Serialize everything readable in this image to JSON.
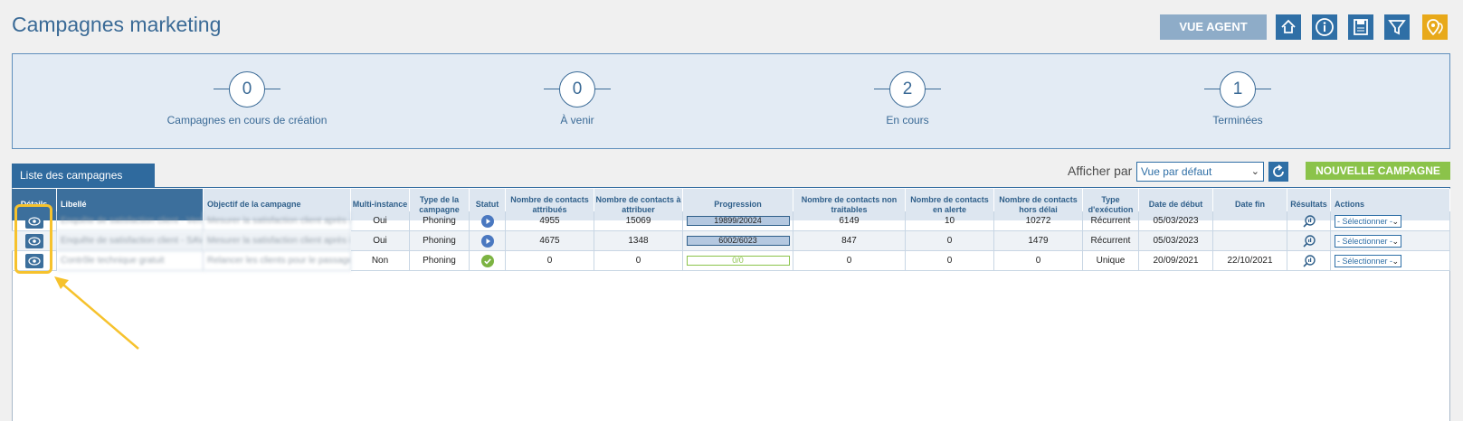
{
  "page": {
    "title": "Campagnes marketing"
  },
  "toolbar": {
    "agent_label": "VUE AGENT",
    "icons": [
      "export-icon",
      "info-icon",
      "save-icon",
      "filter-icon",
      "location-icon"
    ]
  },
  "stats": [
    {
      "value": "0",
      "label": "Campagnes en cours de création"
    },
    {
      "value": "0",
      "label": "À venir"
    },
    {
      "value": "2",
      "label": "En cours"
    },
    {
      "value": "1",
      "label": "Terminées"
    }
  ],
  "tab": {
    "label": "Liste des campagnes"
  },
  "display": {
    "label": "Afficher par",
    "selected": "Vue par défaut",
    "new_campaign": "NOUVELLE CAMPAGNE"
  },
  "table": {
    "headers": [
      "Détails",
      "Libellé",
      "Objectif de la campagne",
      "Multi-instance",
      "Type de la campagne",
      "Statut",
      "Nombre de contacts attribués",
      "Nombre de contacts à attribuer",
      "Progression",
      "Nombre de contacts non traitables",
      "Nombre de contacts en alerte",
      "Nombre de contacts hors délai",
      "Type d'exécution",
      "Date de début",
      "Date fin",
      "Résultats",
      "Actions"
    ],
    "rows": [
      {
        "libelle": "Enquête de satisfaction client - Vente",
        "objectif": "Mesurer la satisfaction client après achat",
        "multi": "Oui",
        "type": "Phoning",
        "statut": "en-cours",
        "attribues": "4955",
        "a_attribuer": "15069",
        "progression": "19899/20024",
        "progress_fraction": 0.99,
        "non_traitables": "6149",
        "alerte": "10",
        "hors_delai": "10272",
        "execution": "Récurrent",
        "debut": "05/03/2023",
        "fin": "",
        "action": "- Sélectionner -"
      },
      {
        "libelle": "Enquête de satisfaction client - SAV",
        "objectif": "Mesurer la satisfaction client après intervention",
        "multi": "Oui",
        "type": "Phoning",
        "statut": "en-cours",
        "attribues": "4675",
        "a_attribuer": "1348",
        "progression": "6002/6023",
        "progress_fraction": 0.99,
        "non_traitables": "847",
        "alerte": "0",
        "hors_delai": "1479",
        "execution": "Récurrent",
        "debut": "05/03/2023",
        "fin": "",
        "action": "- Sélectionner -"
      },
      {
        "libelle": "Contrôle technique gratuit",
        "objectif": "Relancer les clients pour le passage",
        "multi": "Non",
        "type": "Phoning",
        "statut": "terminee",
        "attribues": "0",
        "a_attribuer": "0",
        "progression": "0/0",
        "progress_fraction": 0,
        "non_traitables": "0",
        "alerte": "0",
        "hors_delai": "0",
        "execution": "Unique",
        "debut": "20/09/2021",
        "fin": "22/10/2021",
        "action": "- Sélectionner -"
      }
    ]
  },
  "colors": {
    "primary": "#2f6fa6",
    "accent_green": "#8bc34a",
    "highlight": "#f6c22d",
    "title": "#3a6a96"
  }
}
